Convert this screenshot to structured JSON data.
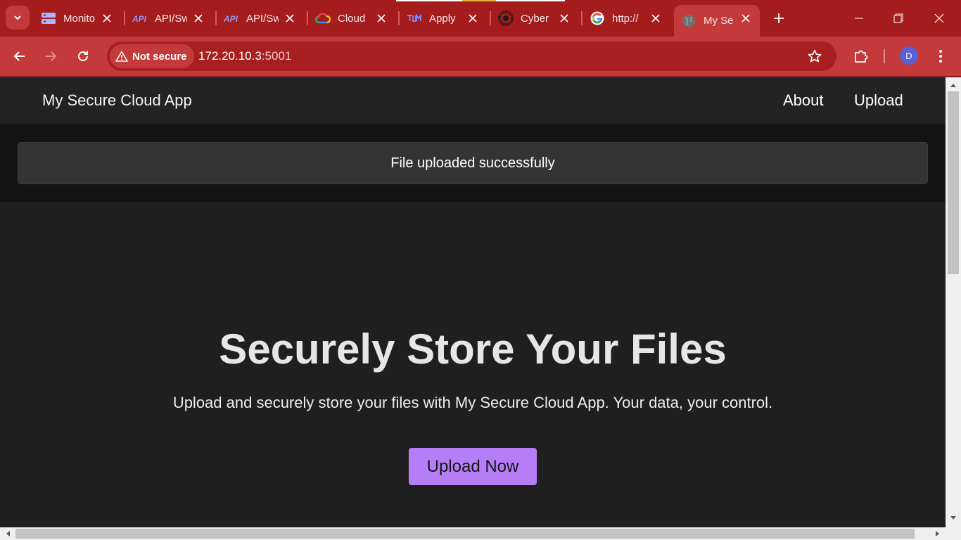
{
  "browser": {
    "tabs": [
      {
        "title": "Monitoring",
        "icon": "dashboard-icon",
        "active": false
      },
      {
        "title": "API/Swagger",
        "icon": "api-icon",
        "active": false
      },
      {
        "title": "API/Swagger",
        "icon": "api-icon",
        "active": false
      },
      {
        "title": "Cloud",
        "icon": "google-cloud-icon",
        "active": false
      },
      {
        "title": "Apply",
        "icon": "tum-logo-icon",
        "active": false
      },
      {
        "title": "Cyber",
        "icon": "cyber-logo-icon",
        "active": false
      },
      {
        "title": "http://",
        "icon": "google-icon",
        "active": false
      },
      {
        "title": "My Secure Cloud App",
        "icon": "globe-icon",
        "active": true
      }
    ],
    "security_label": "Not secure",
    "url_host": "172.20.10.3",
    "url_port": ":5001",
    "profile_initial": "D",
    "accent_color": "#c43a3a"
  },
  "page": {
    "brand": "My Secure Cloud App",
    "nav": {
      "about": "About",
      "upload": "Upload"
    },
    "flash_message": "File uploaded successfully",
    "hero_title": "Securely Store Your Files",
    "hero_subtitle": "Upload and securely store your files with My Secure Cloud App. Your data, your control.",
    "cta_label": "Upload Now",
    "cta_color": "#b57ef7"
  }
}
